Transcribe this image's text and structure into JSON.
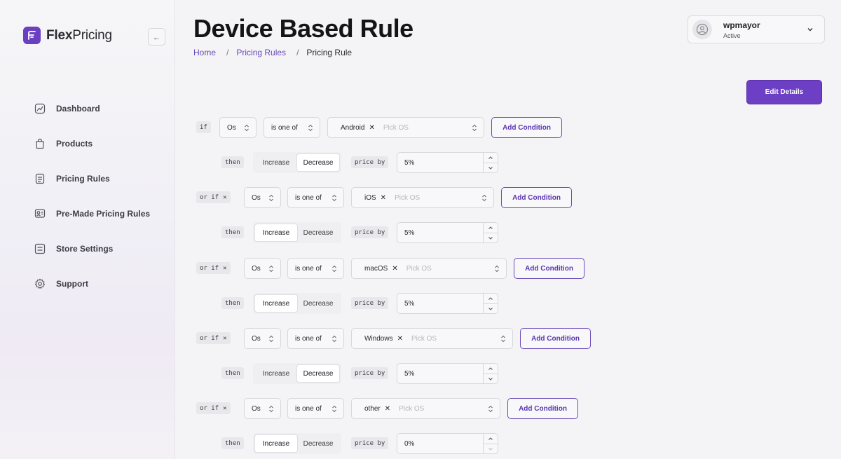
{
  "app": {
    "logo_word_bold": "Flex",
    "logo_word_regular": "Pricing"
  },
  "sidebar": {
    "items": [
      {
        "label": "Dashboard",
        "icon": "chart-icon"
      },
      {
        "label": "Products",
        "icon": "shopping-bag-icon"
      },
      {
        "label": "Pricing Rules",
        "icon": "document-icon"
      },
      {
        "label": "Pre-Made Pricing Rules",
        "icon": "user-card-icon"
      },
      {
        "label": "Store Settings",
        "icon": "sliders-icon"
      },
      {
        "label": "Support",
        "icon": "gear-icon"
      }
    ]
  },
  "header": {
    "title": "Device Based Rule",
    "breadcrumb": [
      "Home",
      "Pricing Rules",
      "Pricing Rule"
    ],
    "breadcrumb_sep": "/",
    "edit_button": "Edit Details"
  },
  "user": {
    "name": "wpmayor",
    "status": "Active"
  },
  "labels": {
    "then": "then",
    "price_by": "price by",
    "placeholder": "Pick OS",
    "add_condition": "Add Condition",
    "increase": "Increase",
    "decrease": "Decrease"
  },
  "rules": [
    {
      "prefix": "if",
      "field": "Os",
      "operator": "is one of",
      "value": "Android",
      "mode": "Decrease",
      "amount": "5%"
    },
    {
      "prefix": "or if",
      "field": "Os",
      "operator": "is one of",
      "value": "iOS",
      "mode": "Increase",
      "amount": "5%"
    },
    {
      "prefix": "or if",
      "field": "Os",
      "operator": "is one of",
      "value": "macOS",
      "mode": "Increase",
      "amount": "5%"
    },
    {
      "prefix": "or if",
      "field": "Os",
      "operator": "is one of",
      "value": "Windows",
      "mode": "Decrease",
      "amount": "5%"
    },
    {
      "prefix": "or if",
      "field": "Os",
      "operator": "is one of",
      "value": "other",
      "mode": "Increase",
      "amount": "0%"
    }
  ],
  "colors": {
    "accent": "#6d3fc4",
    "link": "#6a49b8"
  }
}
